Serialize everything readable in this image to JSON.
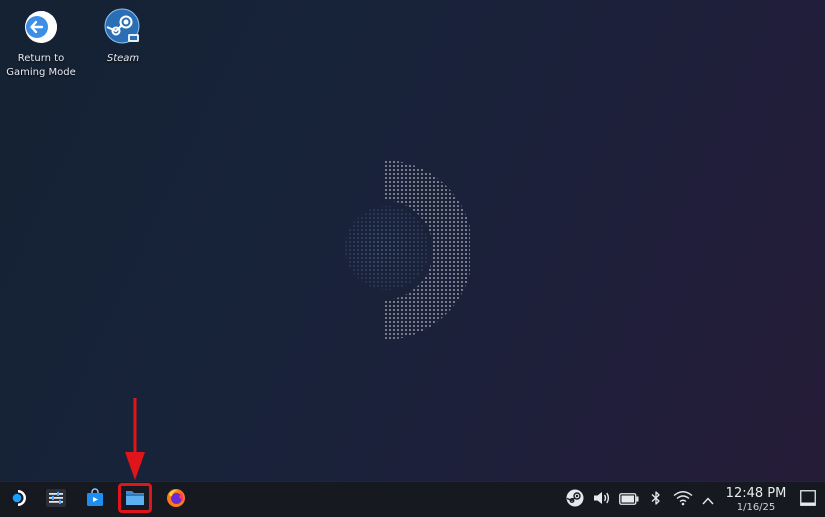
{
  "desktop": {
    "icons": [
      {
        "name": "return-to-gaming-mode",
        "label_line1": "Return to",
        "label_line2": "Gaming Mode",
        "icon": "return-arrow-icon"
      },
      {
        "name": "steam",
        "label": "Steam",
        "icon": "steam-icon"
      }
    ],
    "wallpaper": "steam-deck-dotted-logo",
    "colors": {
      "background_start": "#142233",
      "background_end": "#261c38",
      "logo_dots": "#6d9ac8"
    }
  },
  "taskbar": {
    "apps": [
      {
        "name": "app-launcher",
        "icon": "steamdeck-logo-icon"
      },
      {
        "name": "system-settings",
        "icon": "sliders-icon"
      },
      {
        "name": "discover-store",
        "icon": "shopping-bag-icon"
      },
      {
        "name": "file-manager",
        "icon": "folder-icon",
        "highlighted": true
      },
      {
        "name": "firefox",
        "icon": "firefox-icon"
      }
    ],
    "tray": [
      {
        "name": "steam-tray",
        "icon": "steam-icon"
      },
      {
        "name": "volume",
        "icon": "speaker-icon"
      },
      {
        "name": "battery",
        "icon": "battery-icon"
      },
      {
        "name": "bluetooth",
        "icon": "bluetooth-icon"
      },
      {
        "name": "wifi",
        "icon": "wifi-icon"
      },
      {
        "name": "expand-tray",
        "icon": "chevron-up-icon"
      }
    ],
    "clock": {
      "time": "12:48 PM",
      "date": "1/16/25"
    },
    "show_desktop_icon": "show-desktop-icon"
  },
  "annotation": {
    "color": "#e0141b",
    "target": "file-manager"
  }
}
